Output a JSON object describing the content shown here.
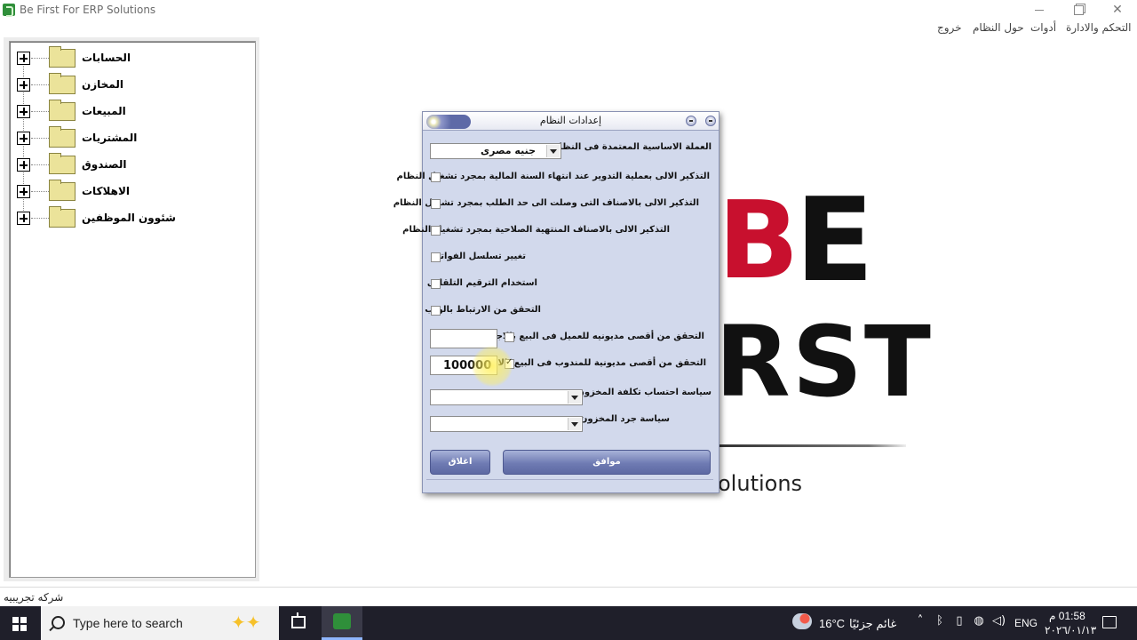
{
  "window": {
    "title": "Be First For ERP Solutions"
  },
  "menu": {
    "items": [
      "التحكم والادارة",
      "أدوات",
      "حول النظام",
      "خروج"
    ]
  },
  "tree": {
    "items": [
      {
        "label": "الحسابات"
      },
      {
        "label": "المخازن"
      },
      {
        "label": "المبيعات"
      },
      {
        "label": "المشتريات"
      },
      {
        "label": "الصندوق"
      },
      {
        "label": "الاهلاكات"
      },
      {
        "label": "شئوون الموظفين"
      }
    ]
  },
  "logo": {
    "b": "B",
    "e": "E",
    "rst": "RST",
    "solutions": "olutions"
  },
  "dialog": {
    "title": "إعدادات النظام",
    "currency_label": "العملة الاساسية المعتمدة فى النظام :",
    "currency_value": "جنيه مصرى",
    "options": [
      {
        "label": "التذكير الالى بعملية التدوير عند انتهاء السنة المالية بمجرد تشغيل النظام",
        "checked": false
      },
      {
        "label": "التذكير الالى بالاصناف التى وصلت الى حد الطلب بمجرد تشغيل النظام",
        "checked": false
      },
      {
        "label": "التذكير الالى بالاصناف المنتهية الصلاحية بمجرد تشغيل النظام",
        "checked": false
      },
      {
        "label": "تغيير تسلسل الفواتير",
        "checked": false
      },
      {
        "label": "استخدام الترقيم التلقائى",
        "checked": false
      },
      {
        "label": "التحقق من الارتباط بالويب",
        "checked": false
      }
    ],
    "customer_debt_label": "التحقق من أقصى مديونيه للعميل فى البيع بالاجل",
    "customer_debt_checked": false,
    "customer_debt_value": "",
    "rep_debt_label": "التحقق من أقصى مديونية للمندوب فى البيع بالاجل",
    "rep_debt_checked": true,
    "rep_debt_value": "100000",
    "cost_policy_label": "سياسة احتساب تكلفة المخزون :",
    "cost_policy_value": "",
    "inventory_policy_label": "سياسة جرد المخزون :",
    "inventory_policy_value": "",
    "close_button": "اغلاق",
    "ok_button": "موافق"
  },
  "status": {
    "company": "شركه تجريبيه"
  },
  "taskbar": {
    "search_placeholder": "Type here to search",
    "temperature": "16°C",
    "weather": "غائم جزئيًا",
    "language": "ENG",
    "time": "01:58 م",
    "date": "٢٠٢٦/٠١/١٣"
  },
  "colors": {
    "accent": "#6f7bb3",
    "dialog_bg": "#d2d9ec",
    "logo_red": "#c8102e"
  }
}
